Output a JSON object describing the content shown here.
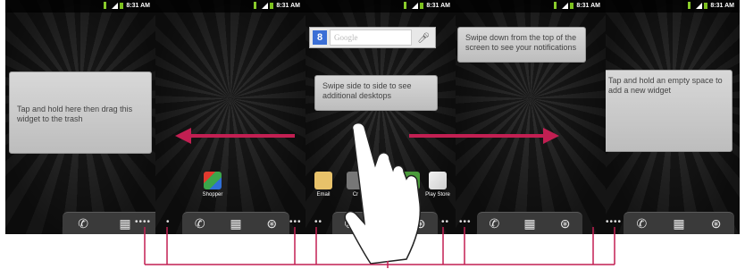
{
  "status_bar": {
    "time": "8:31 AM"
  },
  "screens": {
    "s1": {
      "callout": "Tap and hold here then drag this widget to the trash",
      "dots": "••••"
    },
    "s2": {
      "app": "Shopper",
      "dots_left": "•",
      "dots_right": "•••"
    },
    "s3": {
      "search_placeholder": "Google",
      "callout": "Swipe side to side to see additional desktops",
      "apps": [
        "Email",
        "Cr",
        "",
        "Play Store"
      ],
      "dots_left": "••",
      "dots_right": "••"
    },
    "s4": {
      "callout": "Swipe down from the top of the screen to see your notifications",
      "dots": "•••"
    },
    "s5": {
      "callout": "Tap and hold an empty space to add a new widget",
      "dots_left": "•",
      "dots_right": "••••"
    }
  },
  "dock": {
    "phone_icon": "phone-icon",
    "apps_icon": "app-drawer-icon",
    "browser_icon": "browser-icon"
  },
  "colors": {
    "arrow": "#c21f52",
    "bracket": "#c21f52",
    "screen_bg": "#222222"
  }
}
